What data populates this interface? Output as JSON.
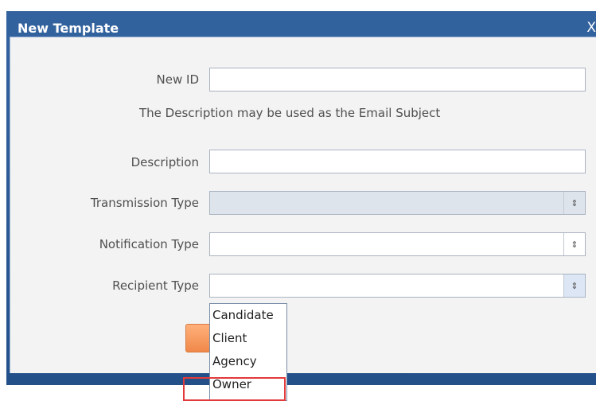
{
  "window": {
    "title": "New Template",
    "close_glyph": "X"
  },
  "form": {
    "new_id_label": "New ID",
    "new_id_value": "",
    "info_text": "The Description may be used as the Email Subject",
    "description_label": "Description",
    "description_value": "",
    "transmission_type_label": "Transmission Type",
    "notification_type_label": "Notification Type",
    "recipient_type_label": "Recipient Type",
    "spinner_glyph": "⇕"
  },
  "recipient_dropdown": {
    "options": [
      "Candidate",
      "Client",
      "Agency",
      "Owner"
    ]
  },
  "colors": {
    "title_bar": "#2b5a96",
    "panel": "#f3f3f3",
    "highlight": "#e23a3a",
    "ok_button": "#f59a5e"
  },
  "icons": [
    "close-icon",
    "spinner-icon"
  ]
}
